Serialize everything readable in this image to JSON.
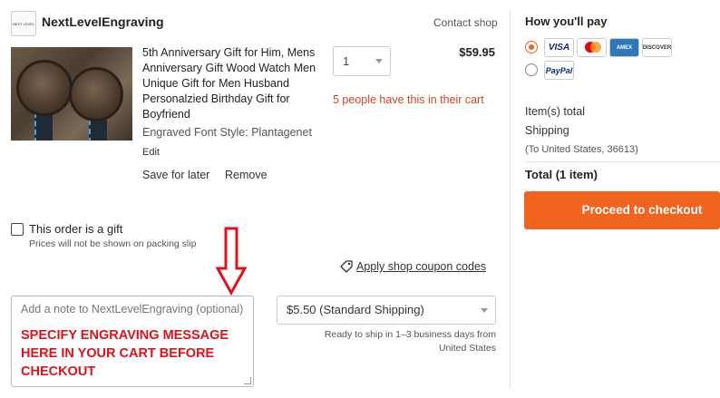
{
  "shop": {
    "logo_text": "NEXT LEVEL",
    "name": "NextLevelEngraving",
    "contact_label": "Contact shop"
  },
  "item": {
    "title": "5th Anniversary Gift for Him, Mens Anniversary Gift Wood Watch Men Unique Gift for Men Husband Personalzied Birthday Gift for Boyfriend",
    "variant": "Engraved Font Style: Plantagenet",
    "edit_label": "Edit",
    "save_for_later_label": "Save for later",
    "remove_label": "Remove",
    "quantity": "1",
    "price": "$59.95",
    "cart_alert": "5 people have this in their cart"
  },
  "gift": {
    "label": "This order is a gift",
    "note": "Prices will not be shown on packing slip"
  },
  "coupon": {
    "label": "Apply shop coupon codes"
  },
  "note": {
    "placeholder": "Add a note to NextLevelEngraving (optional)",
    "instruction": "SPECIFY ENGRAVING MESSAGE HERE IN YOUR CART BEFORE CHECKOUT"
  },
  "shipping": {
    "selected": "$5.50 (Standard Shipping)",
    "ready_text": "Ready to ship in 1–3 business days from United States"
  },
  "payment": {
    "title": "How you'll pay",
    "cards": [
      "VISA",
      "Mastercard",
      "AMEX",
      "DISCOVER"
    ],
    "paypal": "PayPal",
    "accent_color": "#f1641e"
  },
  "totals": {
    "items_label": "Item(s) total",
    "shipping_label": "Shipping",
    "destination": "(To United States, 36613)",
    "total_label": "Total (1 item)"
  },
  "checkout": {
    "label": "Proceed to checkout"
  },
  "annotation": {
    "color": "#e0111a"
  }
}
